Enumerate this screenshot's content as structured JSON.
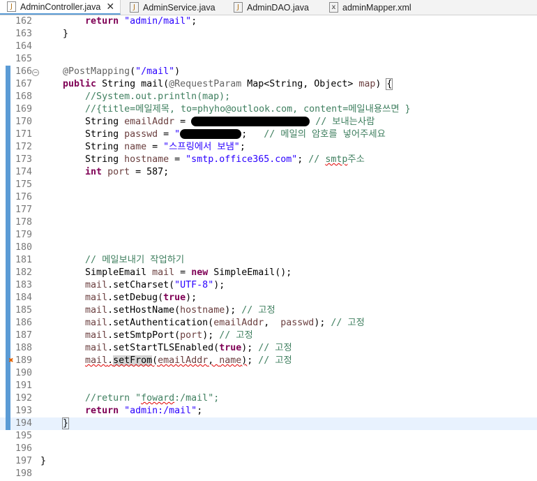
{
  "tabs": [
    {
      "label": "AdminController.java",
      "icon": "java-file-icon",
      "active": true
    },
    {
      "label": "AdminService.java",
      "icon": "java-file-icon",
      "active": false
    },
    {
      "label": "AdminDAO.java",
      "icon": "java-file-icon",
      "active": false
    },
    {
      "label": "adminMapper.xml",
      "icon": "xml-file-icon",
      "active": false
    }
  ],
  "lines": [
    {
      "n": "162",
      "indent": "        ",
      "tokens": [
        {
          "t": "return",
          "c": "kw"
        },
        {
          "t": " "
        },
        {
          "t": "\"admin/mail\"",
          "c": "str"
        },
        {
          "t": ";"
        }
      ]
    },
    {
      "n": "163",
      "indent": "    ",
      "tokens": [
        {
          "t": "}"
        }
      ]
    },
    {
      "n": "164",
      "indent": "",
      "tokens": []
    },
    {
      "n": "165",
      "indent": "",
      "tokens": []
    },
    {
      "n": "166",
      "indent": "    ",
      "fold": true,
      "changed": true,
      "tokens": [
        {
          "t": "@PostMapping",
          "c": "an"
        },
        {
          "t": "("
        },
        {
          "t": "\"/mail\"",
          "c": "str"
        },
        {
          "t": ")"
        }
      ]
    },
    {
      "n": "167",
      "indent": "    ",
      "changed": true,
      "tokens": [
        {
          "t": "public",
          "c": "kw"
        },
        {
          "t": " String mail("
        },
        {
          "t": "@RequestParam",
          "c": "an"
        },
        {
          "t": " Map<String, Object> "
        },
        {
          "t": "map",
          "c": "ld"
        },
        {
          "t": ") "
        },
        {
          "t": "{",
          "c": "bracket"
        }
      ]
    },
    {
      "n": "168",
      "indent": "        ",
      "changed": true,
      "tokens": [
        {
          "t": "//System.out.println(map);",
          "c": "cm"
        }
      ]
    },
    {
      "n": "169",
      "indent": "        ",
      "changed": true,
      "tokens": [
        {
          "t": "//{title=메일제목, to=phyho@outlook.com, content=메일내용쓰면 }",
          "c": "cm"
        }
      ]
    },
    {
      "n": "170",
      "indent": "        ",
      "changed": true,
      "tokens": [
        {
          "t": "String "
        },
        {
          "t": "emailAddr",
          "c": "ld"
        },
        {
          "t": " = "
        },
        {
          "redact": 170
        },
        {
          "t": " "
        },
        {
          "t": "// 보내는사람",
          "c": "cm"
        }
      ]
    },
    {
      "n": "171",
      "indent": "        ",
      "changed": true,
      "tokens": [
        {
          "t": "String "
        },
        {
          "t": "passwd",
          "c": "ld"
        },
        {
          "t": " = "
        },
        {
          "t": "\"",
          "c": "str"
        },
        {
          "redact": 88
        },
        {
          "t": ";   "
        },
        {
          "t": "// 메일의 암호를 넣어주세요",
          "c": "cm"
        }
      ]
    },
    {
      "n": "172",
      "indent": "        ",
      "changed": true,
      "tokens": [
        {
          "t": "String "
        },
        {
          "t": "name",
          "c": "ld"
        },
        {
          "t": " = "
        },
        {
          "t": "\"스프링에서 보냄\"",
          "c": "str"
        },
        {
          "t": ";"
        }
      ]
    },
    {
      "n": "173",
      "indent": "        ",
      "changed": true,
      "tokens": [
        {
          "t": "String "
        },
        {
          "t": "hostname",
          "c": "ld"
        },
        {
          "t": " = "
        },
        {
          "t": "\"smtp.office365.com\"",
          "c": "str"
        },
        {
          "t": "; "
        },
        {
          "t": "// ",
          "c": "cm"
        },
        {
          "t": "smtp",
          "c": "cm squig"
        },
        {
          "t": "주소",
          "c": "cm"
        }
      ]
    },
    {
      "n": "174",
      "indent": "        ",
      "changed": true,
      "tokens": [
        {
          "t": "int",
          "c": "kw"
        },
        {
          "t": " "
        },
        {
          "t": "port",
          "c": "ld"
        },
        {
          "t": " = 587;"
        }
      ]
    },
    {
      "n": "175",
      "indent": "",
      "changed": true,
      "tokens": []
    },
    {
      "n": "176",
      "indent": "",
      "changed": true,
      "tokens": []
    },
    {
      "n": "177",
      "indent": "",
      "changed": true,
      "tokens": []
    },
    {
      "n": "178",
      "indent": "",
      "changed": true,
      "tokens": []
    },
    {
      "n": "179",
      "indent": "",
      "changed": true,
      "tokens": []
    },
    {
      "n": "180",
      "indent": "",
      "changed": true,
      "tokens": []
    },
    {
      "n": "181",
      "indent": "        ",
      "changed": true,
      "tokens": [
        {
          "t": "// 메일보내기 작업하기",
          "c": "cm"
        }
      ]
    },
    {
      "n": "182",
      "indent": "        ",
      "changed": true,
      "tokens": [
        {
          "t": "SimpleEmail "
        },
        {
          "t": "mail",
          "c": "ld"
        },
        {
          "t": " = "
        },
        {
          "t": "new",
          "c": "kw"
        },
        {
          "t": " SimpleEmail();"
        }
      ]
    },
    {
      "n": "183",
      "indent": "        ",
      "changed": true,
      "tokens": [
        {
          "t": "mail",
          "c": "ld"
        },
        {
          "t": ".setCharset("
        },
        {
          "t": "\"UTF-8\"",
          "c": "str"
        },
        {
          "t": ");"
        }
      ]
    },
    {
      "n": "184",
      "indent": "        ",
      "changed": true,
      "tokens": [
        {
          "t": "mail",
          "c": "ld"
        },
        {
          "t": ".setDebug("
        },
        {
          "t": "true",
          "c": "kw"
        },
        {
          "t": ");"
        }
      ]
    },
    {
      "n": "185",
      "indent": "        ",
      "changed": true,
      "tokens": [
        {
          "t": "mail",
          "c": "ld"
        },
        {
          "t": ".setHostName("
        },
        {
          "t": "hostname",
          "c": "ld"
        },
        {
          "t": "); "
        },
        {
          "t": "// 고정",
          "c": "cm"
        }
      ]
    },
    {
      "n": "186",
      "indent": "        ",
      "changed": true,
      "tokens": [
        {
          "t": "mail",
          "c": "ld"
        },
        {
          "t": ".setAuthentication("
        },
        {
          "t": "emailAddr",
          "c": "ld"
        },
        {
          "t": ",  "
        },
        {
          "t": "passwd",
          "c": "ld"
        },
        {
          "t": "); "
        },
        {
          "t": "// 고정",
          "c": "cm"
        }
      ]
    },
    {
      "n": "187",
      "indent": "        ",
      "changed": true,
      "tokens": [
        {
          "t": "mail",
          "c": "ld"
        },
        {
          "t": ".setSmtpPort("
        },
        {
          "t": "port",
          "c": "ld"
        },
        {
          "t": "); "
        },
        {
          "t": "// 고정",
          "c": "cm"
        }
      ]
    },
    {
      "n": "188",
      "indent": "        ",
      "changed": true,
      "tokens": [
        {
          "t": "mail",
          "c": "ld"
        },
        {
          "t": ".setStartTLSEnabled("
        },
        {
          "t": "true",
          "c": "kw"
        },
        {
          "t": "); "
        },
        {
          "t": "// 고정",
          "c": "cm"
        }
      ]
    },
    {
      "n": "189",
      "indent": "        ",
      "changed": true,
      "error": true,
      "tokens": [
        {
          "t": "mail",
          "c": "ld squig"
        },
        {
          "t": ".",
          "c": "squig"
        },
        {
          "t": "setFrom",
          "c": "squig hl"
        },
        {
          "t": "(",
          "c": "squig"
        },
        {
          "t": "emailAddr",
          "c": "ld squig"
        },
        {
          "t": ", ",
          "c": "squig"
        },
        {
          "t": "name",
          "c": "ld squig"
        },
        {
          "t": ")",
          "c": "squig"
        },
        {
          "t": "; "
        },
        {
          "t": "// 고정",
          "c": "cm"
        }
      ]
    },
    {
      "n": "190",
      "indent": "",
      "changed": true,
      "tokens": []
    },
    {
      "n": "191",
      "indent": "",
      "changed": true,
      "tokens": []
    },
    {
      "n": "192",
      "indent": "        ",
      "changed": true,
      "tokens": [
        {
          "t": "//return \"",
          "c": "cm"
        },
        {
          "t": "foward",
          "c": "cm squig"
        },
        {
          "t": ":/mail\";",
          "c": "cm"
        }
      ]
    },
    {
      "n": "193",
      "indent": "        ",
      "changed": true,
      "tokens": [
        {
          "t": "return",
          "c": "kw"
        },
        {
          "t": " "
        },
        {
          "t": "\"admin:/mail\"",
          "c": "str"
        },
        {
          "t": ";"
        }
      ]
    },
    {
      "n": "194",
      "indent": "    ",
      "changed": true,
      "current": true,
      "tokens": [
        {
          "t": "}",
          "c": "bracket"
        },
        {
          "caret": true
        }
      ]
    },
    {
      "n": "195",
      "indent": "",
      "tokens": []
    },
    {
      "n": "196",
      "indent": "",
      "tokens": []
    },
    {
      "n": "197",
      "indent": "",
      "tokens": [
        {
          "t": "}"
        }
      ]
    },
    {
      "n": "198",
      "indent": "",
      "tokens": []
    }
  ]
}
